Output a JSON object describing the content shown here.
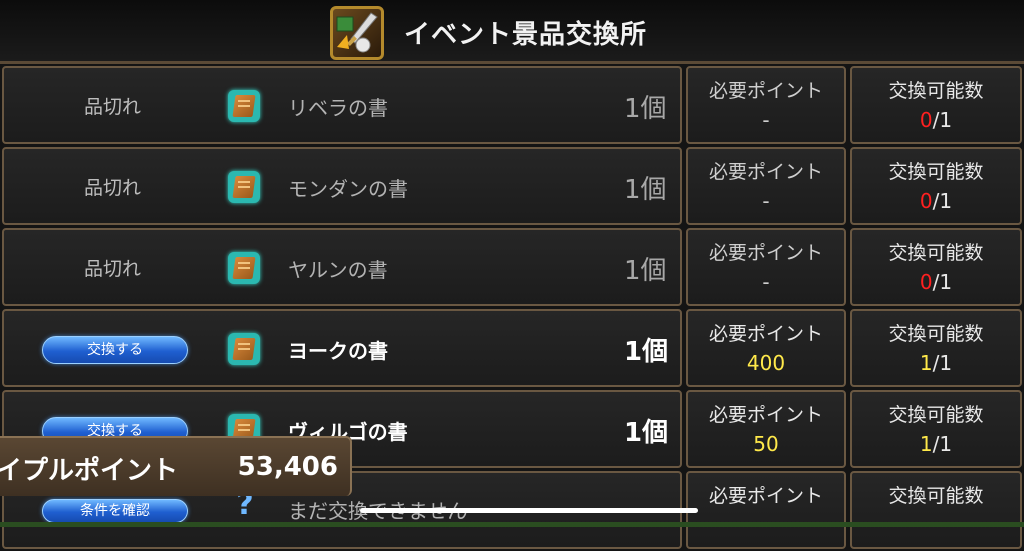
{
  "header": {
    "title": "イベント景品交換所",
    "emblem_icon": "sword-treasure-emblem-icon"
  },
  "columns": {
    "points_label": "必要ポイント",
    "count_label": "交換可能数"
  },
  "rows": [
    {
      "status": "品切れ",
      "action_type": "soldout",
      "item": "リベラの書",
      "icon": "book-icon",
      "qty": "1個",
      "points": "-",
      "count_used": "0",
      "count_total": "/1",
      "count_color": "red",
      "active": false
    },
    {
      "status": "品切れ",
      "action_type": "soldout",
      "item": "モンダンの書",
      "icon": "book-icon",
      "qty": "1個",
      "points": "-",
      "count_used": "0",
      "count_total": "/1",
      "count_color": "red",
      "active": false
    },
    {
      "status": "品切れ",
      "action_type": "soldout",
      "item": "ヤルンの書",
      "icon": "book-icon",
      "qty": "1個",
      "points": "-",
      "count_used": "0",
      "count_total": "/1",
      "count_color": "red",
      "active": false
    },
    {
      "status": "交換する",
      "action_type": "button",
      "item": "ヨークの書",
      "icon": "book-icon",
      "qty": "1個",
      "points": "400",
      "count_used": "1",
      "count_total": "/1",
      "count_color": "yellow",
      "active": true
    },
    {
      "status": "交換する",
      "action_type": "button",
      "item": "ヴィルゴの書",
      "icon": "book-icon",
      "qty": "1個",
      "points": "50",
      "count_used": "1",
      "count_total": "/1",
      "count_color": "yellow",
      "active": true
    },
    {
      "status": "条件を確認",
      "action_type": "button",
      "item": "まだ交換できません",
      "icon": "question-mark-icon",
      "qty": "",
      "points": "",
      "count_used": "",
      "count_total": "",
      "count_color": "yellow",
      "active": false
    }
  ],
  "points_panel": {
    "label": "イプルポイント",
    "value": "53,406"
  }
}
